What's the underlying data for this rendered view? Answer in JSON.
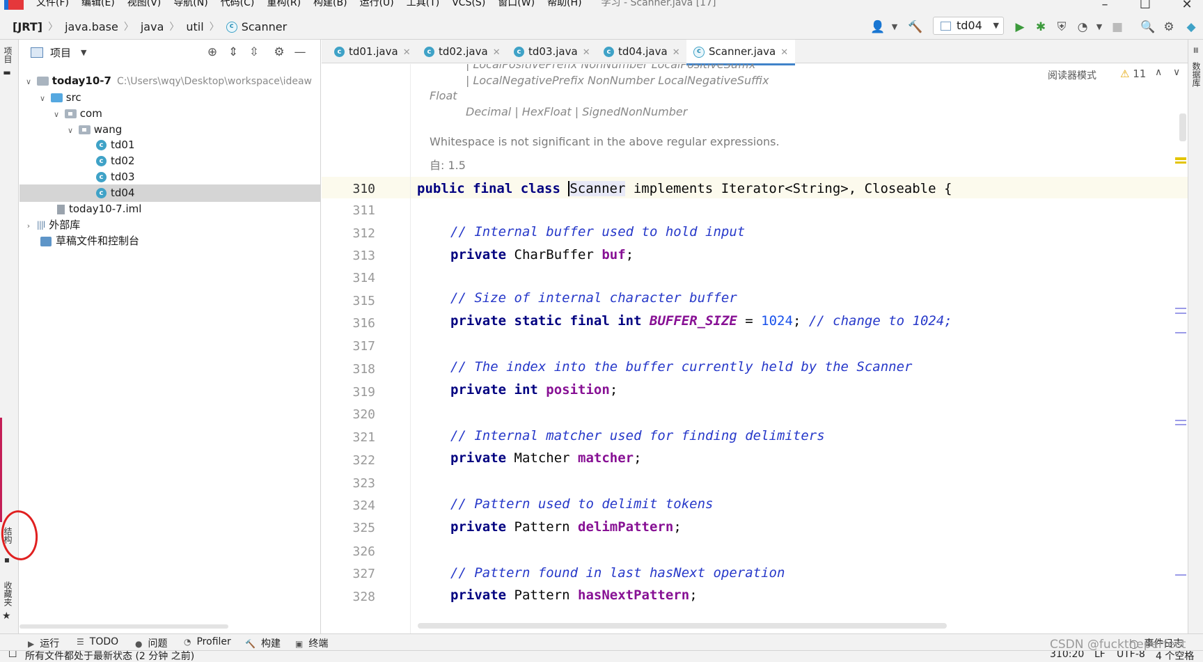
{
  "menubar": {
    "items": [
      "文件(F)",
      "编辑(E)",
      "视图(V)",
      "导航(N)",
      "代码(C)",
      "重构(R)",
      "构建(B)",
      "运行(U)",
      "工具(T)",
      "VCS(S)",
      "窗口(W)",
      "帮助(H)"
    ],
    "window_title": "学习 - Scanner.java [17]"
  },
  "breadcrumb": {
    "items": [
      "[JRT]",
      "java.base",
      "java",
      "util",
      "Scanner"
    ]
  },
  "run_config": {
    "label": "td04"
  },
  "left_strip": {
    "project_tab": "项目",
    "structure_tab": "结构",
    "favorites_tab": "收藏夹"
  },
  "project_panel": {
    "title": "项目",
    "tree": [
      {
        "label": "today10-7",
        "path": "C:\\Users\\wqy\\Desktop\\workspace\\ideaw",
        "bold": true
      },
      {
        "label": "src"
      },
      {
        "label": "com"
      },
      {
        "label": "wang"
      },
      {
        "label": "td01"
      },
      {
        "label": "td02"
      },
      {
        "label": "td03"
      },
      {
        "label": "td04"
      },
      {
        "label": "today10-7.iml"
      },
      {
        "label": "外部库"
      },
      {
        "label": "草稿文件和控制台"
      }
    ]
  },
  "editor_tabs": [
    "td01.java",
    "td02.java",
    "td03.java",
    "td04.java",
    "Scanner.java"
  ],
  "editor": {
    "reader_mode": "阅读器模式",
    "warnings": "11",
    "doc": {
      "line_a": "|  LocalPositivePrefix NonNumber LocalPositiveSuffix",
      "line_b": "|  LocalNegativePrefix NonNumber LocalNegativeSuffix",
      "float_label": "Float",
      "float_def": "Decimal |   HexFloat |   SignedNonNumber",
      "whitespace_note": "Whitespace is not significant in the above regular expressions.",
      "since": "自: 1.5"
    },
    "line_numbers": [
      "310",
      "311",
      "312",
      "313",
      "314",
      "315",
      "316",
      "317",
      "318",
      "319",
      "320",
      "321",
      "322",
      "323",
      "324",
      "325",
      "326",
      "327",
      "328"
    ],
    "code": {
      "l310_a": "public final class ",
      "l310_cls": "Scanner",
      "l310_b": " implements Iterator<String>, Closeable {",
      "l312": "// Internal buffer used to hold input",
      "l313_kw": "private",
      "l313_type": " CharBuffer ",
      "l313_field": "buf",
      "l315": "// Size of internal character buffer",
      "l316_kw": "private static final int",
      "l316_field": "BUFFER_SIZE",
      "l316_eq": " = ",
      "l316_num": "1024",
      "l316_semi": "; ",
      "l316_cm": "// change to 1024;",
      "l318": "// The index into the buffer currently held by the Scanner",
      "l319_kw": "private int",
      "l319_field": "position",
      "l321": "// Internal matcher used for finding delimiters",
      "l322_kw": "private",
      "l322_type": " Matcher ",
      "l322_field": "matcher",
      "l324": "// Pattern used to delimit tokens",
      "l325_kw": "private",
      "l325_type": " Pattern ",
      "l325_field": "delimPattern",
      "l327": "// Pattern found in last hasNext operation",
      "l328_kw": "private",
      "l328_type": " Pattern ",
      "l328_field": "hasNextPattern",
      "semi": ";"
    }
  },
  "right_strip": {
    "database_tab": "数据库"
  },
  "bottom_tools": [
    "运行",
    "TODO",
    "问题",
    "Profiler",
    "构建",
    "终端"
  ],
  "event_log": "事件日志",
  "status": {
    "message": "所有文件都处于最新状态 (2 分钟 之前)",
    "position": "310:20",
    "line_sep": "LF",
    "encoding": "UTF-8",
    "indent": "4 个空格"
  },
  "watermark": "CSDN @fucktheperfect",
  "colors": {
    "keyword": "#000080",
    "comment": "#2638c9",
    "field": "#871094",
    "number": "#1750eb",
    "accent": "#4083c9",
    "annotation_circle": "#e02020"
  }
}
